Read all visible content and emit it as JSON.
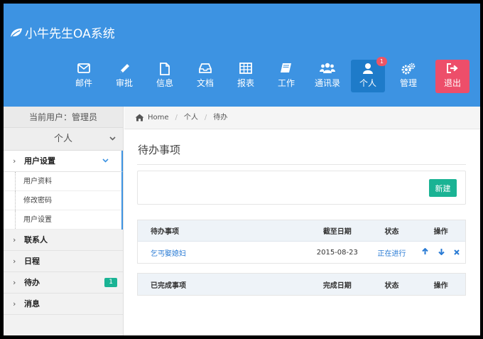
{
  "app": {
    "title": "小牛先生OA系统"
  },
  "nav": {
    "items": [
      {
        "label": "邮件",
        "icon": "envelope-icon"
      },
      {
        "label": "审批",
        "icon": "pencil-icon"
      },
      {
        "label": "信息",
        "icon": "file-icon"
      },
      {
        "label": "文档",
        "icon": "inbox-icon"
      },
      {
        "label": "报表",
        "icon": "table-icon"
      },
      {
        "label": "工作",
        "icon": "book-icon"
      },
      {
        "label": "通讯录",
        "icon": "users-icon"
      },
      {
        "label": "个人",
        "icon": "user-icon",
        "badge": "1",
        "active": true
      },
      {
        "label": "管理",
        "icon": "cogs-icon"
      },
      {
        "label": "退出",
        "icon": "sign-out-icon"
      }
    ]
  },
  "sidebar": {
    "current_user": "当前用户：管理员",
    "section": "个人",
    "menu": [
      {
        "label": "用户设置",
        "open": true,
        "children": [
          "用户资料",
          "修改密码",
          "用户设置"
        ]
      },
      {
        "label": "联系人"
      },
      {
        "label": "日程"
      },
      {
        "label": "待办",
        "badge": "1"
      },
      {
        "label": "消息"
      }
    ]
  },
  "breadcrumb": {
    "home": "Home",
    "items": [
      "个人",
      "待办"
    ]
  },
  "main": {
    "title": "待办事项",
    "new_button": "新建",
    "pending_table": {
      "headers": [
        "待办事项",
        "截至日期",
        "状态",
        "操作"
      ],
      "rows": [
        {
          "title": "乞丐娶媳妇",
          "date": "2015-08-23",
          "status": "正在进行"
        }
      ]
    },
    "done_table": {
      "headers": [
        "已完成事项",
        "完成日期",
        "状态",
        "操作"
      ],
      "rows": []
    }
  },
  "colors": {
    "header_bg": "#3d93e2",
    "active_nav": "#1e7bc9",
    "logout": "#ed4e6a",
    "badge_red": "#ed5565",
    "accent_green": "#1ab394",
    "link": "#2a7bd4"
  }
}
